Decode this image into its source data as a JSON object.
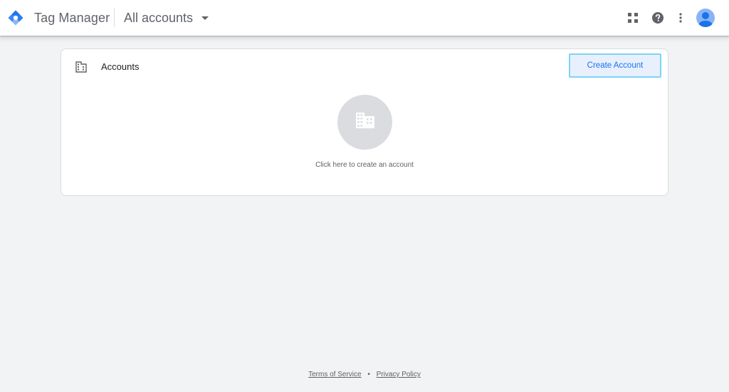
{
  "header": {
    "app_title": "Tag Manager",
    "account_selector": "All accounts"
  },
  "accounts_card": {
    "title": "Accounts",
    "create_button": "Create Account",
    "empty_state_text": "Click here to create an account"
  },
  "footer": {
    "terms": "Terms of Service",
    "separator": "•",
    "privacy": "Privacy Policy"
  },
  "icons": {
    "logo": "tag-manager-logo",
    "apps": "apps-grid-icon",
    "help": "help-icon",
    "more": "more-vert-icon",
    "avatar": "account-avatar-icon",
    "building": "building-icon"
  },
  "colors": {
    "accent": "#1a73e8",
    "button_bg": "#e8f0fe",
    "button_border": "#7cd3f7",
    "page_bg": "#f1f3f4",
    "avatar": "#8ab4f8"
  }
}
